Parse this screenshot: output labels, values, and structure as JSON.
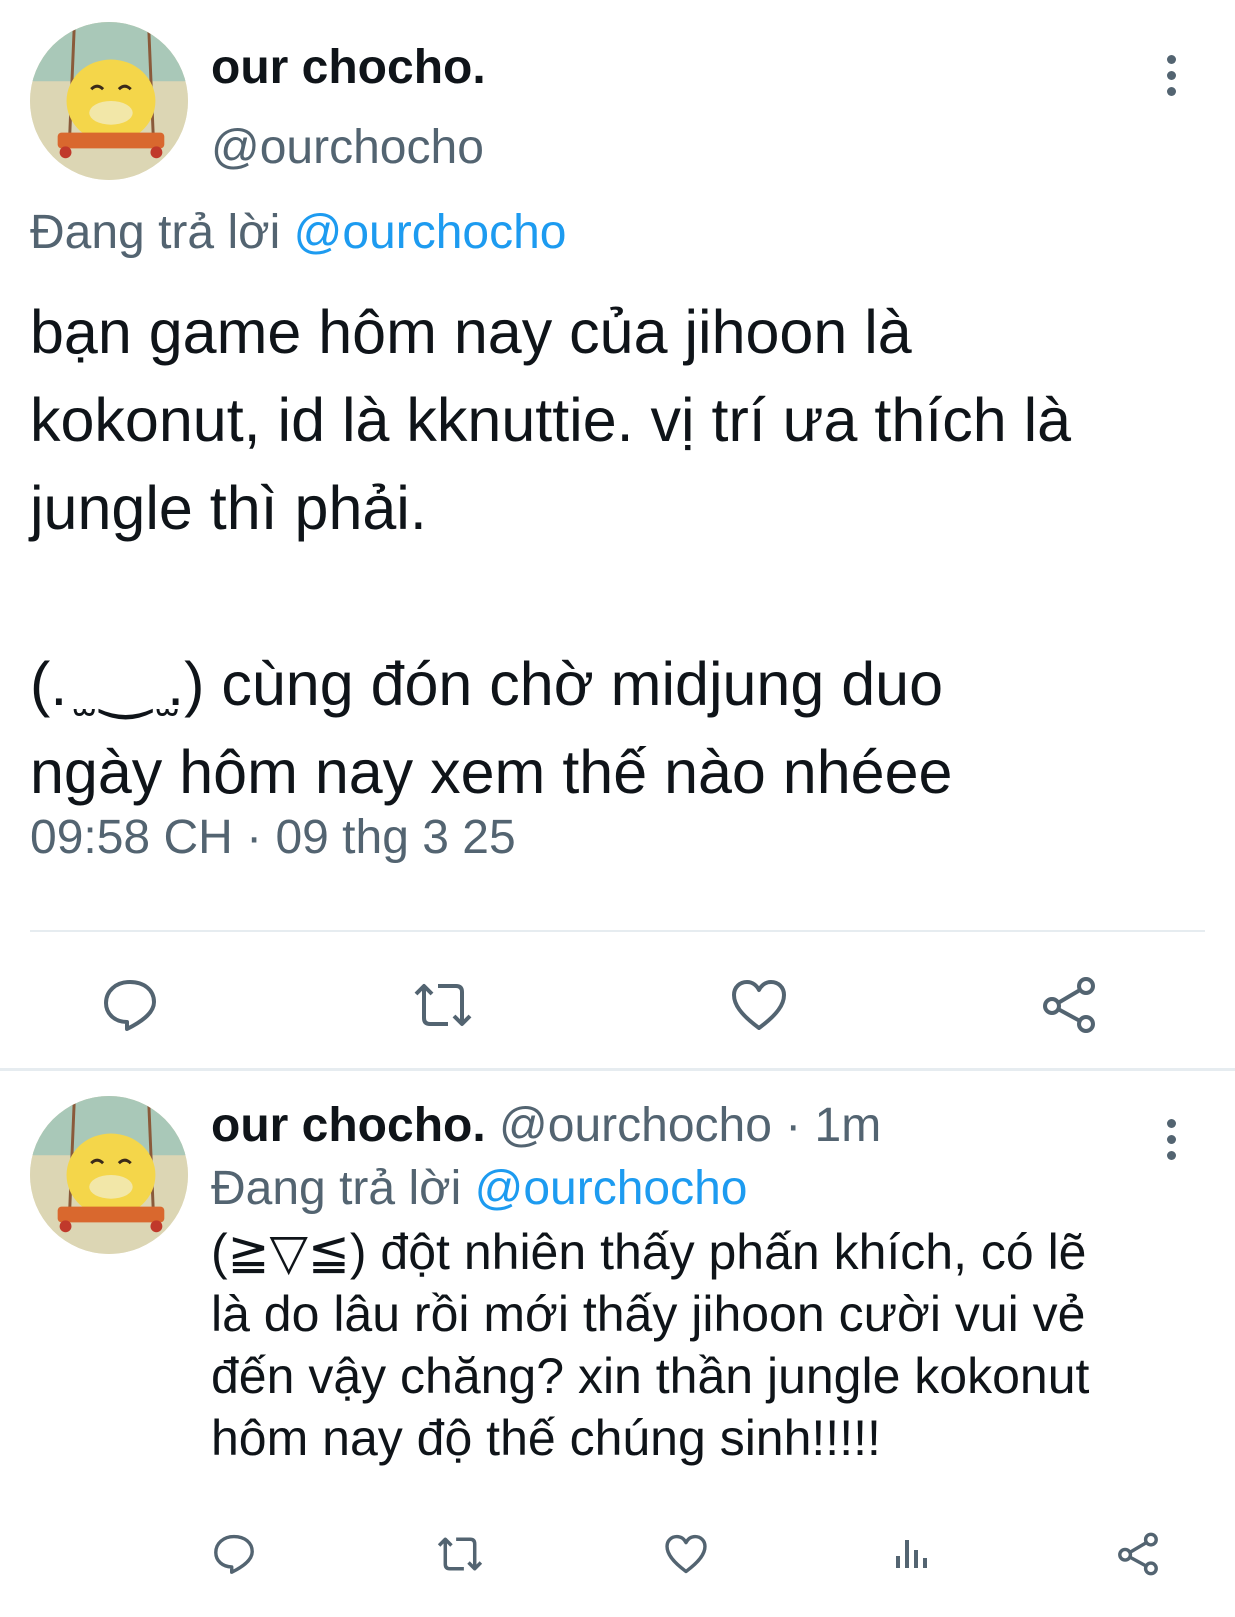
{
  "main_tweet": {
    "display_name": "our chocho.",
    "handle": "@ourchocho",
    "replying_prefix": "Đang trả lời",
    "replying_to": "@ourchocho",
    "text_lines": [
      "bạn game hôm nay của jihoon là",
      "kokonut, id là kknuttie. vị trí ưa thích là",
      "jungle thì phải.",
      "",
      "(. ̫ ‿ ̫.) cùng đón chờ midjung duo",
      "ngày hôm nay xem thế nào nhéee"
    ],
    "timestamp": "09:58 CH · 09 thg 3 25",
    "actions": [
      "reply-icon",
      "retweet-icon",
      "like-icon",
      "share-icon"
    ]
  },
  "reply_tweet": {
    "display_name": "our chocho.",
    "handle_time": "@ourchocho · 1m",
    "replying_prefix": "Đang trả lời",
    "replying_to": "@ourchocho",
    "text_lines": [
      "(≧▽≦)  đột nhiên thấy phấn khích, có lẽ",
      "là do lâu rồi mới thấy jihoon cười vui vẻ",
      "đến vậy chăng? xin thần jungle kokonut",
      "hôm nay độ thế chúng sinh!!!!!"
    ],
    "actions": [
      "reply-icon",
      "retweet-icon",
      "like-icon",
      "analytics-icon",
      "share-icon"
    ]
  },
  "colors": {
    "text_primary": "#0f1419",
    "text_secondary": "#536471",
    "link": "#1d9bf0",
    "divider": "#e6ecf0"
  }
}
